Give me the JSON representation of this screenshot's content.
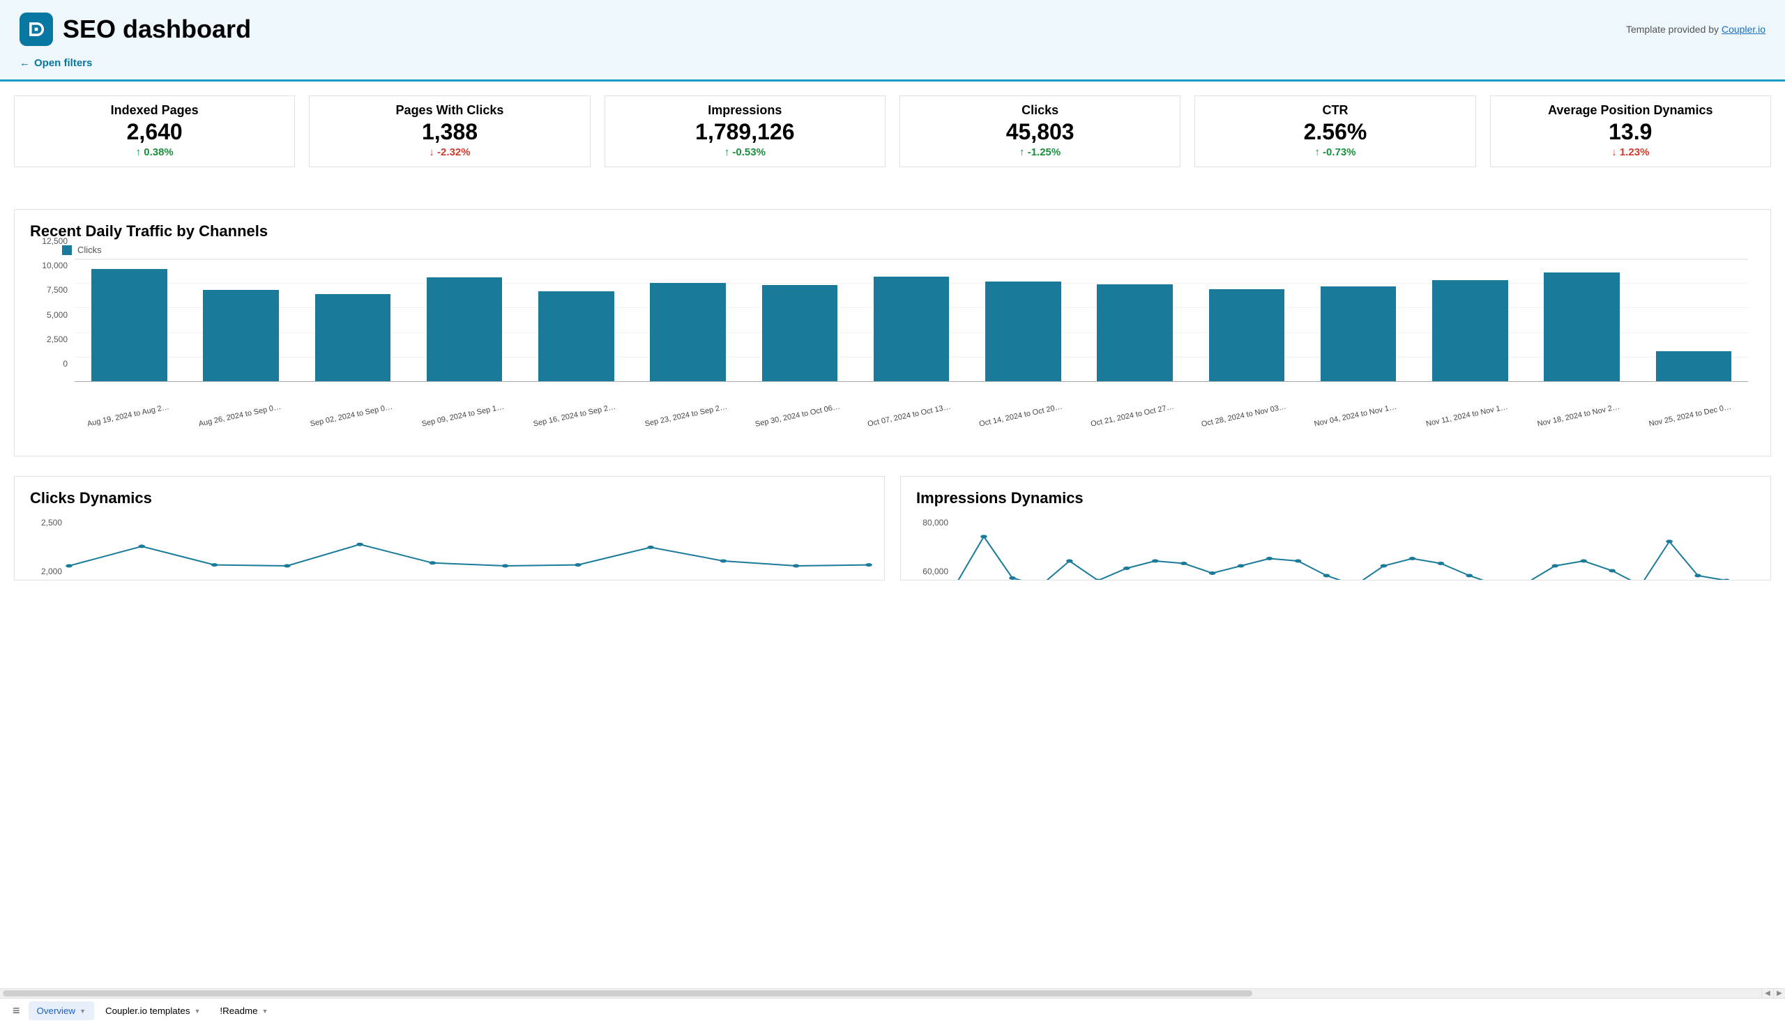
{
  "header": {
    "title": "SEO dashboard",
    "template_prefix": "Template provided by ",
    "template_link": "Coupler.io",
    "open_filters": "Open filters"
  },
  "metrics": [
    {
      "title": "Indexed Pages",
      "value": "2,640",
      "change": "0.38%",
      "dir": "up"
    },
    {
      "title": "Pages With Clicks",
      "value": "1,388",
      "change": "-2.32%",
      "dir": "down"
    },
    {
      "title": "Impressions",
      "value": "1,789,126",
      "change": "-0.53%",
      "dir": "up"
    },
    {
      "title": "Clicks",
      "value": "45,803",
      "change": "-1.25%",
      "dir": "up"
    },
    {
      "title": "CTR",
      "value": "2.56%",
      "change": "-0.73%",
      "dir": "up"
    },
    {
      "title": "Average Position Dynamics",
      "value": "13.9",
      "change": "1.23%",
      "dir": "down"
    }
  ],
  "chart_data": {
    "type": "bar",
    "title": "Recent Daily Traffic by Channels",
    "legend": "Clicks",
    "ylabel": "",
    "ylim": [
      0,
      12500
    ],
    "y_ticks": [
      "0",
      "2,500",
      "5,000",
      "7,500",
      "10,000",
      "12,500"
    ],
    "categories": [
      "Aug 19, 2024 to Aug 2…",
      "Aug 26, 2024 to Sep 0…",
      "Sep 02, 2024 to Sep 0…",
      "Sep 09, 2024 to Sep 1…",
      "Sep 16, 2024 to Sep 2…",
      "Sep 23, 2024 to Sep 2…",
      "Sep 30, 2024 to Oct 06…",
      "Oct 07, 2024 to Oct 13…",
      "Oct 14, 2024 to Oct 20…",
      "Oct 21, 2024 to Oct 27…",
      "Oct 28, 2024 to Nov 03…",
      "Nov 04, 2024 to Nov 1…",
      "Nov 11, 2024 to Nov 1…",
      "Nov 18, 2024 to Nov 2…",
      "Nov 25, 2024 to Dec 0…"
    ],
    "values": [
      11600,
      9400,
      9000,
      10700,
      9300,
      10100,
      9900,
      10800,
      10300,
      10000,
      9500,
      9800,
      10400,
      11200,
      3100
    ]
  },
  "clicks_dynamics": {
    "type": "line",
    "title": "Clicks Dynamics",
    "y_ticks": [
      "2,000",
      "2,500"
    ],
    "ylim": [
      2000,
      2500
    ],
    "values": [
      2000,
      2200,
      2010,
      2000,
      2220,
      2030,
      2000,
      2010,
      2190,
      2050,
      2000,
      2010
    ]
  },
  "impressions_dynamics": {
    "type": "line",
    "title": "Impressions Dynamics",
    "y_ticks": [
      "60,000",
      "80,000"
    ],
    "ylim": [
      60000,
      80000
    ],
    "values": [
      52000,
      72000,
      55000,
      52000,
      62000,
      54000,
      59000,
      62000,
      61000,
      57000,
      60000,
      63000,
      62000,
      56000,
      52000,
      60000,
      63000,
      61000,
      56000,
      52000,
      53000,
      60000,
      62000,
      58000,
      52000,
      70000,
      56000,
      54000,
      52000
    ]
  },
  "tabs": {
    "active": "Overview",
    "items": [
      "Overview",
      "Coupler.io templates",
      "!Readme"
    ]
  }
}
